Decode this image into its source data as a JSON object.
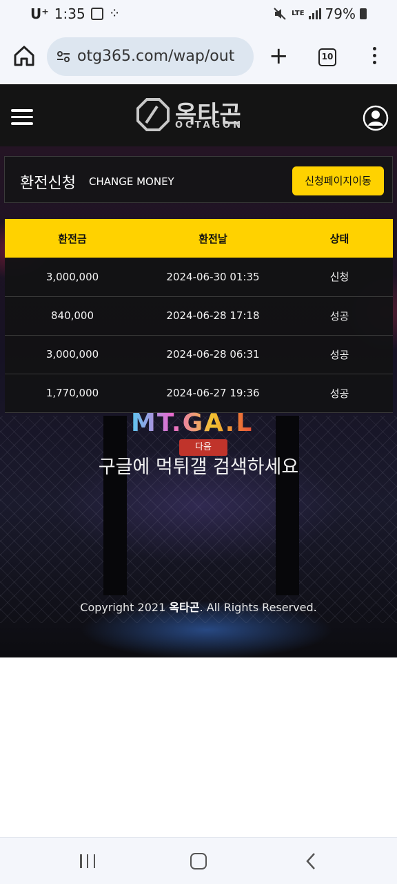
{
  "status_bar": {
    "carrier": "U⁺",
    "time": "1:35",
    "network": "LTE",
    "battery": "79%"
  },
  "browser": {
    "url": "otg365.com/wap/out",
    "tab_count": "10"
  },
  "site": {
    "logo_kr": "옥타곤",
    "logo_en": "OCTAGON",
    "panel_title_kr": "환전신청",
    "panel_title_en": "CHANGE MONEY",
    "go_button": "신청페이지이동",
    "table": {
      "headers": [
        "환전금",
        "환전날",
        "상태"
      ],
      "rows": [
        {
          "amount": "3,000,000",
          "date": "2024-06-30 01:35",
          "status": "신청"
        },
        {
          "amount": "840,000",
          "date": "2024-06-28 17:18",
          "status": "성공"
        },
        {
          "amount": "3,000,000",
          "date": "2024-06-28 06:31",
          "status": "성공"
        },
        {
          "amount": "1,770,000",
          "date": "2024-06-27 19:36",
          "status": "성공"
        }
      ]
    },
    "watermark": {
      "logo": "MT.GA.L",
      "badge": "다음",
      "text": "구글에 먹튀갤 검색하세요"
    },
    "copyright_prefix": "Copyright 2021 ",
    "copyright_brand": "옥타곤",
    "copyright_suffix": ". All Rights Reserved."
  },
  "colors": {
    "accent": "#ffd200",
    "header_bg": "#141414"
  }
}
